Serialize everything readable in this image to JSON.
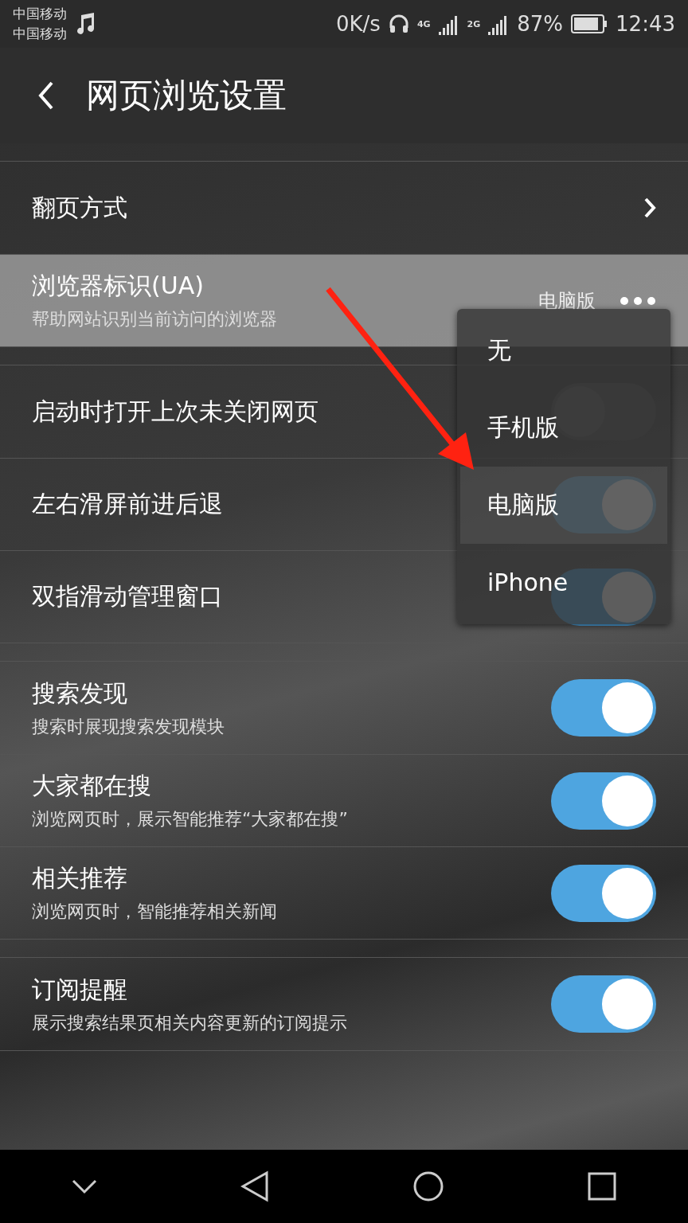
{
  "status_bar": {
    "carriers": [
      "中国移动",
      "中国移动"
    ],
    "speed": "0K/s",
    "networks": [
      "4G",
      "2G"
    ],
    "battery": "87%",
    "time": "12:43"
  },
  "header": {
    "title": "网页浏览设置"
  },
  "sections": [
    {
      "rows": [
        {
          "kind": "link",
          "title": "翻页方式"
        },
        {
          "kind": "value",
          "title": "浏览器标识(UA)",
          "subtitle": "帮助网站识别当前访问的浏览器",
          "value": "电脑版",
          "highlighted": true
        }
      ]
    },
    {
      "rows": [
        {
          "kind": "toggle",
          "title": "启动时打开上次未关闭网页",
          "on": false
        },
        {
          "kind": "toggle",
          "title": "左右滑屏前进后退",
          "on": true
        },
        {
          "kind": "toggle",
          "title": "双指滑动管理窗口",
          "on": true
        }
      ]
    },
    {
      "rows": [
        {
          "kind": "toggle",
          "title": "搜索发现",
          "subtitle": "搜索时展现搜索发现模块",
          "on": true
        },
        {
          "kind": "toggle",
          "title": "大家都在搜",
          "subtitle": "浏览网页时，展示智能推荐“大家都在搜”",
          "on": true
        },
        {
          "kind": "toggle",
          "title": "相关推荐",
          "subtitle": "浏览网页时，智能推荐相关新闻",
          "on": true
        }
      ]
    },
    {
      "rows": [
        {
          "kind": "toggle",
          "title": "订阅提醒",
          "subtitle": "展示搜索结果页相关内容更新的订阅提示",
          "on": true
        }
      ]
    }
  ],
  "menu": {
    "items": [
      {
        "label": "无",
        "selected": false
      },
      {
        "label": "手机版",
        "selected": false
      },
      {
        "label": "电脑版",
        "selected": true
      },
      {
        "label": "iPhone",
        "selected": false
      }
    ]
  }
}
